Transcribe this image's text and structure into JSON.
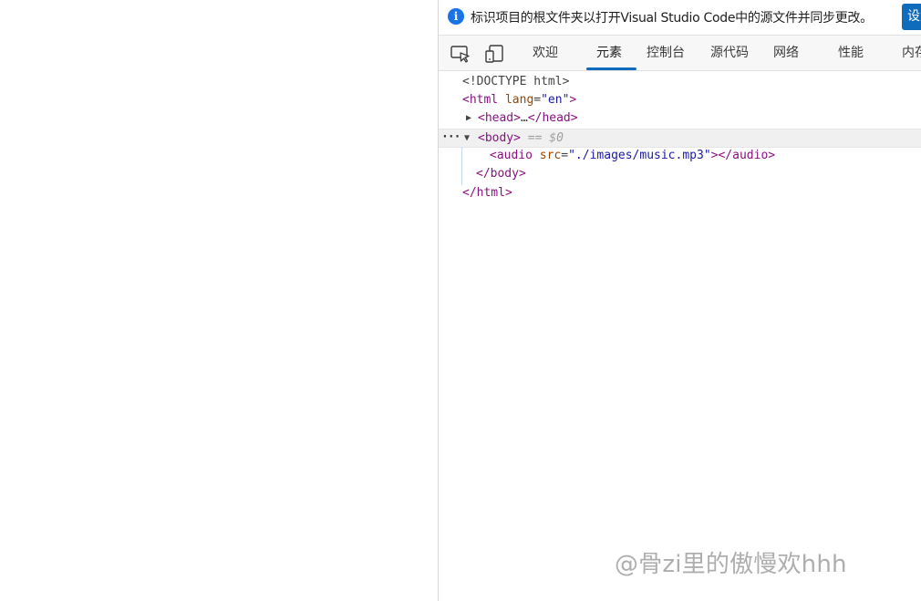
{
  "infobar": {
    "message": "标识项目的根文件夹以打开Visual Studio Code中的源文件并同步更改。",
    "button_label": "设置",
    "icon": "info-icon"
  },
  "toolbar": {
    "inspect_icon": "inspect-element-icon",
    "device_icon": "device-emulation-icon",
    "tabs": [
      {
        "label": "欢迎",
        "active": false
      },
      {
        "label": "元素",
        "active": true
      },
      {
        "label": "控制台",
        "active": false
      },
      {
        "label": "源代码",
        "active": false
      },
      {
        "label": "网络",
        "active": false
      },
      {
        "label": "性能",
        "active": false
      },
      {
        "label": "内存",
        "active": false
      }
    ]
  },
  "dom": {
    "doctype": "<!DOCTYPE html>",
    "html_open": {
      "tag": "html",
      "attr_name": "lang",
      "attr_value": "\"en\""
    },
    "head": {
      "open": "<head>",
      "ellipsis": "…",
      "close": "</head>"
    },
    "body": {
      "open": "<body>",
      "ref": "== $0"
    },
    "audio": {
      "tag": "audio",
      "attr_name": "src",
      "attr_value": "\"./images/music.mp3\"",
      "close": "</audio>"
    },
    "body_close": "</body>",
    "html_close": "</html>"
  },
  "watermark": "@骨zi里的傲慢欢hhh",
  "colors": {
    "accent": "#0f6cbd",
    "info_icon": "#1a73e8",
    "tag": "#881280",
    "attr": "#994500",
    "value": "#1a1aa6"
  }
}
